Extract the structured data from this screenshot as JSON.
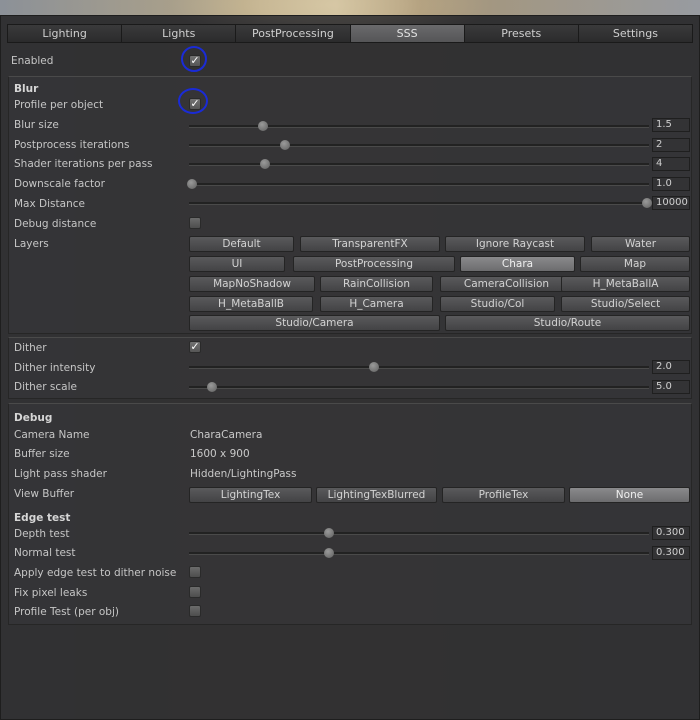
{
  "tabs": [
    {
      "label": "Lighting",
      "active": false
    },
    {
      "label": "Lights",
      "active": false
    },
    {
      "label": "PostProcessing",
      "active": false
    },
    {
      "label": "SSS",
      "active": true
    },
    {
      "label": "Presets",
      "active": false
    },
    {
      "label": "Settings",
      "active": false
    }
  ],
  "enabled": {
    "label": "Enabled",
    "checked": true
  },
  "blur": {
    "heading": "Blur",
    "profile_per_object": {
      "label": "Profile per object",
      "checked": true
    },
    "blur_size": {
      "label": "Blur size",
      "value": "1.5",
      "fraction": 0.155
    },
    "postprocess_iterations": {
      "label": "Postprocess iterations",
      "value": "2",
      "fraction": 0.205
    },
    "shader_iterations": {
      "label": "Shader iterations per pass",
      "value": "4",
      "fraction": 0.16
    },
    "downscale_factor": {
      "label": "Downscale factor",
      "value": "1.0",
      "fraction": 0.0
    },
    "max_distance": {
      "label": "Max Distance",
      "value": "10000",
      "fraction": 1.0
    },
    "debug_distance": {
      "label": "Debug distance",
      "checked": false
    },
    "layers": {
      "label": "Layers",
      "rows": [
        [
          {
            "label": "Default"
          },
          {
            "label": "TransparentFX"
          },
          {
            "label": "Ignore Raycast"
          },
          {
            "label": "Water"
          }
        ],
        [
          {
            "label": "UI"
          },
          {
            "label": "PostProcessing"
          },
          {
            "label": "Chara",
            "active": true
          },
          {
            "label": "Map"
          }
        ],
        [
          {
            "label": "MapNoShadow"
          },
          {
            "label": "RainCollision"
          },
          {
            "label": "CameraCollision"
          },
          {
            "label": "H_MetaBallA"
          }
        ],
        [
          {
            "label": "H_MetaBallB"
          },
          {
            "label": "H_Camera"
          },
          {
            "label": "Studio/Col"
          },
          {
            "label": "Studio/Select"
          }
        ],
        [
          {
            "label": "Studio/Camera"
          },
          {
            "label": "Studio/Route"
          }
        ]
      ]
    }
  },
  "dither": {
    "dither": {
      "label": "Dither",
      "checked": true
    },
    "intensity": {
      "label": "Dither intensity",
      "value": "2.0",
      "fraction": 0.4
    },
    "scale": {
      "label": "Dither scale",
      "value": "5.0",
      "fraction": 0.045
    }
  },
  "debug": {
    "heading": "Debug",
    "camera_name": {
      "label": "Camera Name",
      "value": "CharaCamera"
    },
    "buffer_size": {
      "label": "Buffer size",
      "value": "1600 x 900"
    },
    "light_pass_shader": {
      "label": "Light pass shader",
      "value": "Hidden/LightingPass"
    },
    "view_buffer": {
      "label": "View Buffer",
      "options": [
        {
          "label": "LightingTex"
        },
        {
          "label": "LightingTexBlurred"
        },
        {
          "label": "ProfileTex"
        },
        {
          "label": "None",
          "active": true
        }
      ]
    },
    "edge_heading": "Edge test",
    "depth_test": {
      "label": "Depth test",
      "value": "0.300",
      "fraction": 0.3
    },
    "normal_test": {
      "label": "Normal test",
      "value": "0.300",
      "fraction": 0.3
    },
    "apply_edge_dither": {
      "label": "Apply edge test to dither noise",
      "checked": false
    },
    "fix_pixel_leaks": {
      "label": "Fix pixel leaks",
      "checked": false
    },
    "profile_test": {
      "label": "Profile Test (per obj)",
      "checked": false
    }
  },
  "annotation_color": "#1a2bd6"
}
